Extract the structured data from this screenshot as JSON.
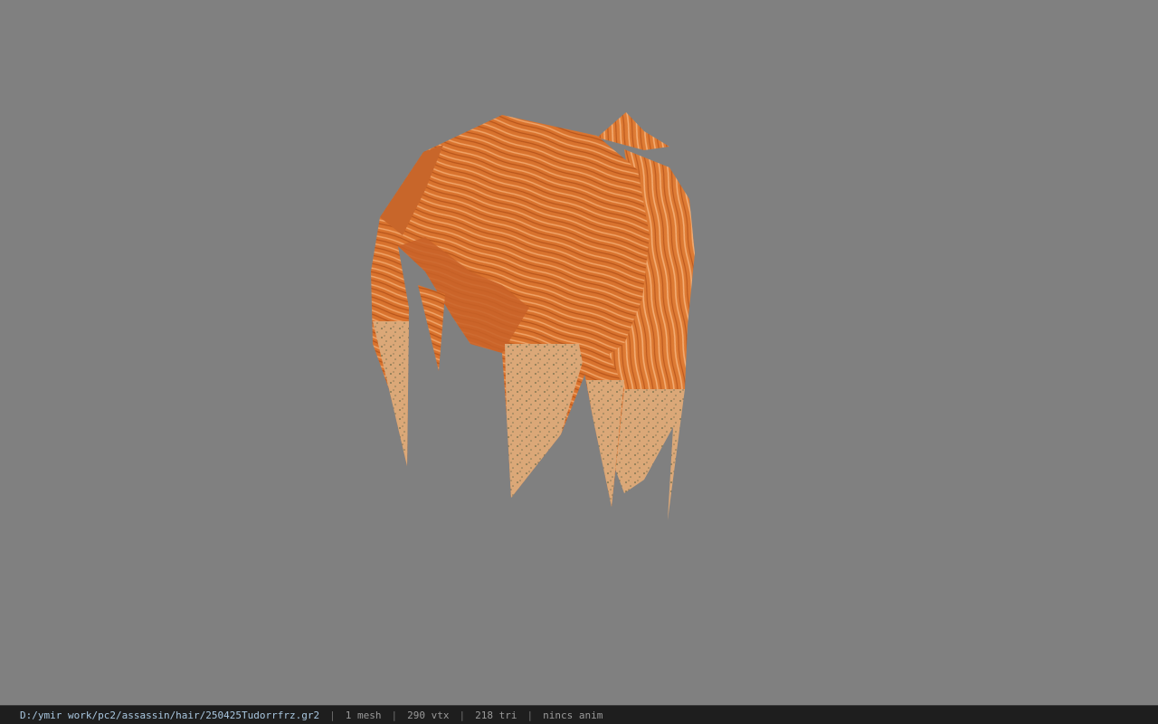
{
  "viewport": {
    "background_color": "#808080",
    "model": {
      "icon": "hair-mesh",
      "colors": {
        "base": "#d9732e",
        "dark_strand": "#b8561c",
        "light_strand": "#f0a468",
        "tip": "#dba878",
        "tip_speckle": "#6b6a48"
      }
    }
  },
  "status_bar": {
    "file_path": "D:/ymir work/pc2/assassin/hair/250425Tudorrfrz.gr2",
    "separator": "|",
    "mesh_count": "1 mesh",
    "vertex_count": "290 vtx",
    "triangle_count": "218 tri",
    "animation": "nincs anim"
  }
}
